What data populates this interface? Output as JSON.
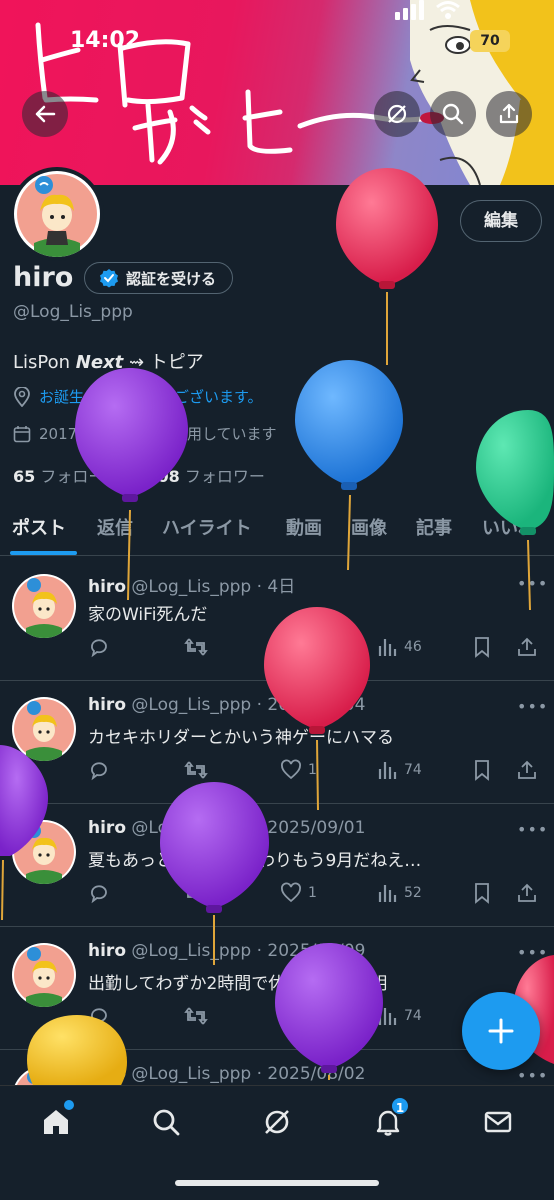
{
  "status_bar": {
    "time": "14:02",
    "battery": "70"
  },
  "banner": {
    "handwriting": "ヒロだよ〜"
  },
  "profile": {
    "name": "hiro",
    "verify_label": "認証を受ける",
    "edit_label": "編集",
    "handle": "@Log_Lis_ppp",
    "bio_prefix": "LisPon ",
    "bio_bold": "Next",
    "bio_suffix": " ⇝ トピア",
    "birthday_text": "お誕生日おめでとうございます。",
    "joined_text": "2017年1月からXを利用しています",
    "following_count": "65",
    "following_label": "フォロー中",
    "followers_count": "108",
    "followers_label": "フォロワー"
  },
  "tabs": [
    {
      "label": "ポスト",
      "active": true
    },
    {
      "label": "返信"
    },
    {
      "label": "ハイライト"
    },
    {
      "label": "動画"
    },
    {
      "label": "画像"
    },
    {
      "label": "記事"
    },
    {
      "label": "いいね"
    }
  ],
  "posts": [
    {
      "name": "hiro",
      "meta": "@Log_Lis_ppp · 4日",
      "text": "家のWiFi死んだ",
      "replies": "",
      "reposts": "",
      "likes": "1",
      "views": "46"
    },
    {
      "name": "hiro",
      "meta": "@Log_Lis_ppp · 2025/09/04",
      "text": "カセキホリダーとかいう神ゲーにハマる",
      "replies": "",
      "reposts": "",
      "likes": "1",
      "views": "74"
    },
    {
      "name": "hiro",
      "meta": "@Log_Lis_ppp · 2025/09/01",
      "text": "夏もあっという間に終わりもう9月だねえ…",
      "replies": "",
      "reposts": "",
      "likes": "1",
      "views": "52"
    },
    {
      "name": "hiro",
      "meta": "@Log_Lis_ppp · 2025/08/09",
      "text": "出勤してわずか2時間で休憩は意味不明",
      "replies": "",
      "reposts": "",
      "likes": "1",
      "views": "74"
    },
    {
      "name": "hiro",
      "meta": "@Log_Lis_ppp · 2025/08/02",
      "text": "",
      "replies": "",
      "reposts": "",
      "likes": "",
      "views": ""
    }
  ],
  "bottom_nav": {
    "notification_count": "1"
  },
  "colors": {
    "accent": "#1d9bf0",
    "background": "#15202b",
    "secondary_text": "#8b98a5"
  },
  "icons": [
    "back-arrow-icon",
    "grok-icon",
    "search-icon",
    "share-icon",
    "verified-icon",
    "location-icon",
    "calendar-icon",
    "reply-icon",
    "repost-icon",
    "like-icon",
    "views-icon",
    "bookmark-icon",
    "share-icon",
    "home-icon",
    "search-icon",
    "grok-icon",
    "bell-icon",
    "mail-icon",
    "plus-icon"
  ]
}
